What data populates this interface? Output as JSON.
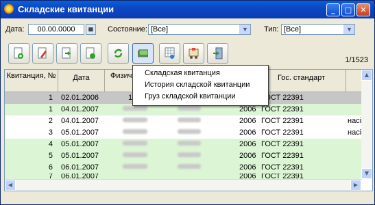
{
  "window": {
    "title": "Складские квитанции",
    "buttons": {
      "minimize": "_",
      "maximize": "□",
      "close": "✕"
    }
  },
  "filters": {
    "date_label": "Дата:",
    "date_value": "00.00.0000",
    "state_label": "Состояние:",
    "state_value": "[Все]",
    "type_label": "Тип:",
    "type_value": "[Все]"
  },
  "toolbar": {
    "tools": [
      "add-doc-icon",
      "edit-doc-icon",
      "export-doc-icon",
      "import-doc-icon",
      "refresh-icon",
      "cash-icon",
      "filter-table-icon",
      "warehouse-cart-icon",
      "exit-door-icon"
    ],
    "pressed_index": 5,
    "record_counter": "1/1523"
  },
  "grid": {
    "columns": [
      "Квитанция, №",
      "Дата",
      "Физич вес,",
      "",
      "",
      "",
      "Гос. стандарт"
    ],
    "rows": [
      {
        "num": "1",
        "date": "02.01.2006",
        "phys": "14",
        "year": "",
        "standard": "ГОСТ 22391",
        "extra": "",
        "style": "sel"
      },
      {
        "num": "1",
        "date": "04.01.2007",
        "phys": "",
        "year": "2006",
        "standard": "ГОСТ 22391",
        "extra": "",
        "style": "green"
      },
      {
        "num": "2",
        "date": "04.01.2007",
        "phys": "",
        "year": "2006",
        "standard": "ГОСТ 22391",
        "extra": "насі",
        "style": "white"
      },
      {
        "num": "3",
        "date": "05.01.2007",
        "phys": "",
        "year": "2006",
        "standard": "ГОСТ 22391",
        "extra": "насі",
        "style": "white"
      },
      {
        "num": "4",
        "date": "05.01.2007",
        "phys": "",
        "year": "2006",
        "standard": "ГОСТ 22391",
        "extra": "",
        "style": "green"
      },
      {
        "num": "5",
        "date": "05.01.2007",
        "phys": "",
        "year": "2006",
        "standard": "ГОСТ 22391",
        "extra": "",
        "style": "green"
      },
      {
        "num": "6",
        "date": "06.01.2007",
        "phys": "",
        "year": "2006",
        "standard": "ГОСТ 22391",
        "extra": "",
        "style": "green"
      },
      {
        "num": "7",
        "date": "06.01.2007",
        "phys": "",
        "year": "2006",
        "standard": "ГОСТ 22391",
        "extra": "",
        "style": "green"
      }
    ]
  },
  "context_menu": {
    "items": [
      "Складская квитанция",
      "История складской квитанции",
      "Груз складской квитанции"
    ]
  },
  "colors": {
    "title_bar": "#0a3db3",
    "row_green": "#dcf5d4",
    "row_selected": "#c6c6c6"
  }
}
